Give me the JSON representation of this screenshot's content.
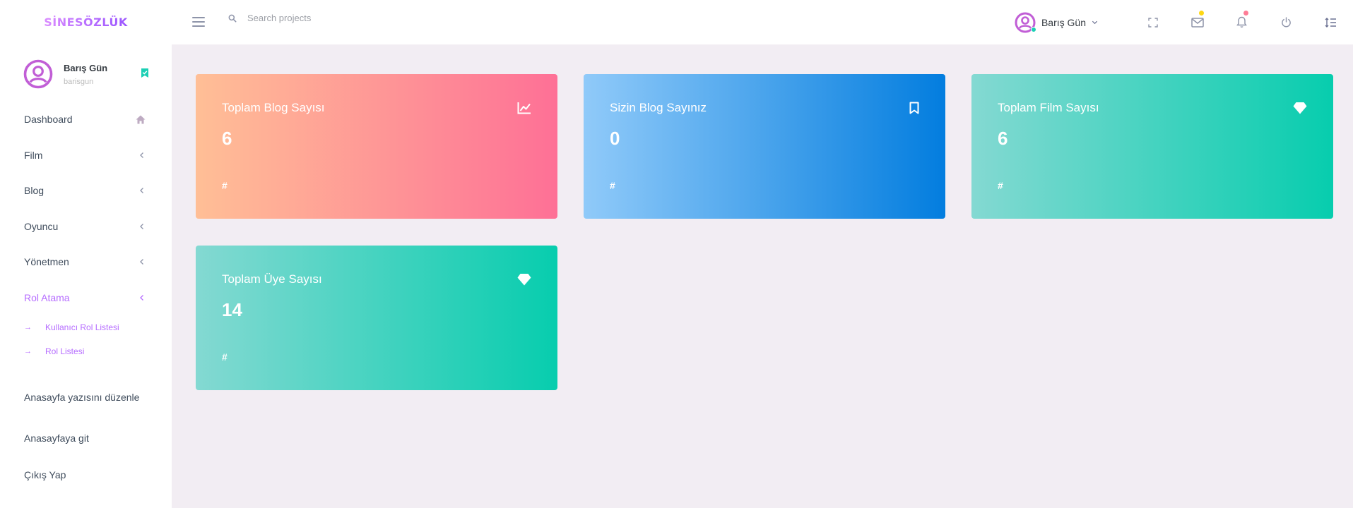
{
  "brand": {
    "logo_text": "SİNESÖZLÜK"
  },
  "search": {
    "placeholder": "Search projects"
  },
  "navbar": {
    "profile_name": "Barış Gün",
    "icons": [
      "fullscreen-icon",
      "mail-icon",
      "bell-icon",
      "power-icon",
      "list-menu-icon"
    ],
    "mail_badge_color": "#fed713",
    "bell_badge_color": "#fe7c96"
  },
  "sidebar": {
    "user": {
      "name": "Barış Gün",
      "handle": "barisgun"
    },
    "items": [
      {
        "label": "Dashboard",
        "icon": "home-icon"
      },
      {
        "label": "Film",
        "icon": "chevron-left-icon"
      },
      {
        "label": "Blog",
        "icon": "chevron-left-icon"
      },
      {
        "label": "Oyuncu",
        "icon": "chevron-left-icon"
      },
      {
        "label": "Yönetmen",
        "icon": "chevron-left-icon"
      },
      {
        "label": "Rol Atama",
        "icon": "chevron-left-icon",
        "active": true
      }
    ],
    "sub_items": [
      {
        "label": "Kullanıcı Rol Listesi"
      },
      {
        "label": "Rol Listesi"
      }
    ],
    "bottom_items": [
      {
        "label": "Anasayfa yazısını düzenle"
      },
      {
        "label": "Anasayfaya git"
      },
      {
        "label": "Çıkış Yap"
      }
    ]
  },
  "cards": [
    {
      "title": "Toplam Blog Sayısı",
      "value": "6",
      "footer": "#",
      "icon": "chart-line-icon",
      "style": "danger"
    },
    {
      "title": "Sizin Blog Sayınız",
      "value": "0",
      "footer": "#",
      "icon": "bookmark-icon",
      "style": "info"
    },
    {
      "title": "Toplam Film Sayısı",
      "value": "6",
      "footer": "#",
      "icon": "diamond-icon",
      "style": "success"
    },
    {
      "title": "Toplam Üye Sayısı",
      "value": "14",
      "footer": "#",
      "icon": "diamond-icon",
      "style": "success"
    }
  ],
  "colors": {
    "accent": "#b66dff",
    "background": "#f2edf3",
    "online": "#1bcfb4"
  }
}
